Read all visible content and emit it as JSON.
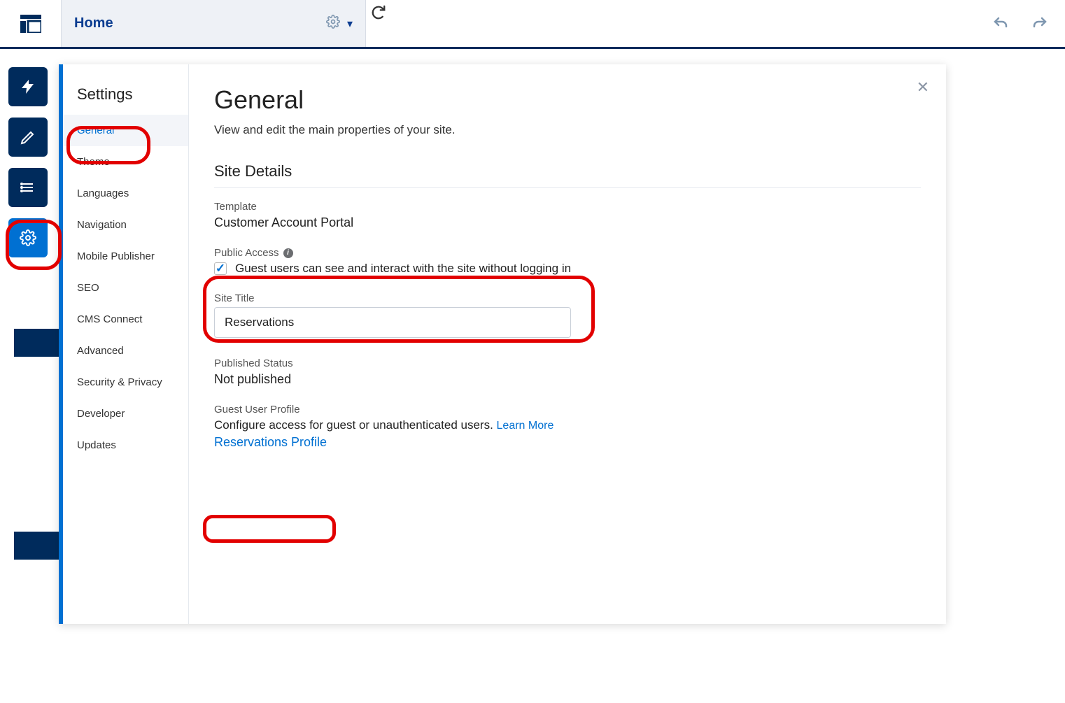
{
  "header": {
    "page_label": "Home"
  },
  "settings": {
    "title": "Settings",
    "items": [
      "General",
      "Theme",
      "Languages",
      "Navigation",
      "Mobile Publisher",
      "SEO",
      "CMS Connect",
      "Advanced",
      "Security & Privacy",
      "Developer",
      "Updates"
    ],
    "selected_index": 0
  },
  "panel": {
    "title": "General",
    "description": "View and edit the main properties of your site.",
    "site_details_heading": "Site Details",
    "template_label": "Template",
    "template_value": "Customer Account Portal",
    "public_access_label": "Public Access",
    "public_access_checkbox_label": "Guest users can see and interact with the site without logging in",
    "public_access_checked": true,
    "site_title_label": "Site Title",
    "site_title_value": "Reservations",
    "published_status_label": "Published Status",
    "published_status_value": "Not published",
    "guest_profile_label": "Guest User Profile",
    "guest_profile_text": "Configure access for guest or unauthenticated users. ",
    "guest_profile_learn_more": "Learn More",
    "guest_profile_link": "Reservations Profile"
  }
}
